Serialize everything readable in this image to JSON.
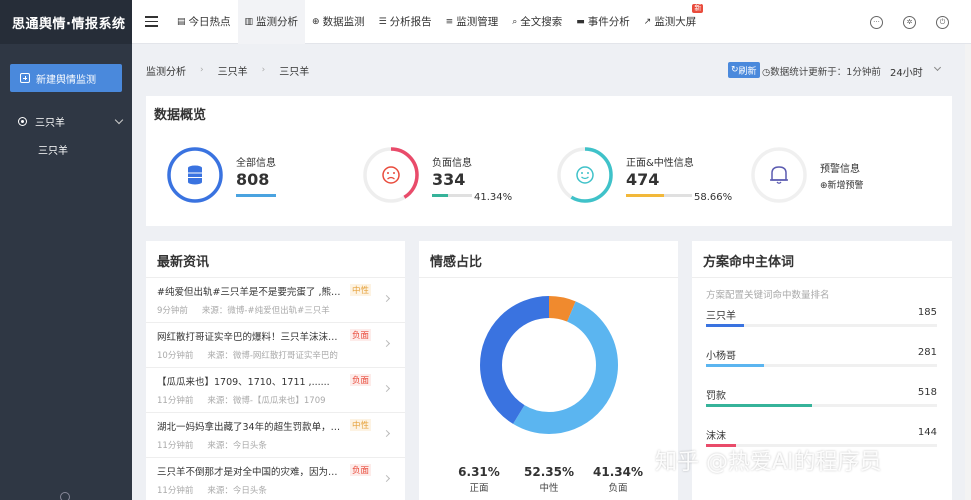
{
  "app": {
    "title": "思通舆情·情报系统"
  },
  "sidebar": {
    "new_button": "新建舆情监测",
    "group_label": "三只羊",
    "child_label": "三只羊"
  },
  "topnav": {
    "items": [
      {
        "label": "今日热点",
        "icon": "newspaper-icon"
      },
      {
        "label": "监测分析",
        "icon": "bar-chart-icon"
      },
      {
        "label": "数据监测",
        "icon": "crosshair-icon"
      },
      {
        "label": "分析报告",
        "icon": "list-icon"
      },
      {
        "label": "监测管理",
        "icon": "menu-list-icon"
      },
      {
        "label": "全文搜索",
        "icon": "search-icon"
      },
      {
        "label": "事件分析",
        "icon": "card-icon"
      },
      {
        "label": "监测大屏",
        "icon": "line-chart-icon",
        "badge": "新"
      }
    ]
  },
  "breadcrumb": {
    "items": [
      "监测分析",
      "三只羊",
      "三只羊"
    ]
  },
  "status": {
    "refresh_label": "刷新",
    "update_text": "数据统计更新于：1分钟前",
    "range": "24小时"
  },
  "overview": {
    "title": "数据概览",
    "total": {
      "label": "全部信息",
      "value": "808"
    },
    "negative": {
      "label": "负面信息",
      "value": "334",
      "percent": "41.34%"
    },
    "positive": {
      "label": "正面&中性信息",
      "value": "474",
      "percent": "58.66%"
    },
    "alert": {
      "label": "预警信息",
      "action": "新增预警"
    }
  },
  "news": {
    "title": "最新资讯",
    "items": [
      {
        "title": "#纯爱但出轨#三只羊是不是要完蛋了 ,熊大熊......",
        "time": "9分钟前",
        "source": "来源：微博-#纯爱但出轨#三只羊",
        "tag": "中性",
        "tag_type": "neutral"
      },
      {
        "title": "网红散打哥证实辛巴的爆料！三只羊沫沫被抓......",
        "time": "10分钟前",
        "source": "来源：微博-网红散打哥证实辛巴的",
        "tag": "负面",
        "tag_type": "negative"
      },
      {
        "title": "【瓜瓜来也】1709、1710、1711 ,......",
        "time": "11分钟前",
        "source": "来源：微博-【瓜瓜来也】1709",
        "tag": "负面",
        "tag_type": "negative"
      },
      {
        "title": "湖北一妈妈拿出藏了34年的超生罚款单，拍......",
        "time": "11分钟前",
        "source": "来源：今日头条",
        "tag": "中性",
        "tag_type": "neutral"
      },
      {
        "title": "三只羊不倒那才是对全中国的灾难，因为其他......",
        "time": "11分钟前",
        "source": "来源：今日头条",
        "tag": "负面",
        "tag_type": "negative"
      }
    ]
  },
  "sentiment": {
    "title": "情感占比",
    "colors": {
      "positive": "#f08a2e",
      "neutral": "#5bb5f0",
      "negative": "#3a73e0"
    }
  },
  "chart_data": {
    "type": "pie",
    "categories": [
      "正面",
      "中性",
      "负面"
    ],
    "values": [
      6.31,
      52.35,
      41.34
    ],
    "labels": [
      "6.31%",
      "52.35%",
      "41.34%"
    ]
  },
  "keywords": {
    "title": "方案命中主体词",
    "caption": "方案配置关键词命中数量排名",
    "items": [
      {
        "name": "三只羊",
        "count": 185,
        "color": "#3a73e0"
      },
      {
        "name": "小杨哥",
        "count": 281,
        "color": "#5bb5f0"
      },
      {
        "name": "罚款",
        "count": 518,
        "color": "#36b39a"
      },
      {
        "name": "沫沫",
        "count": 144,
        "color": "#e94b6a"
      }
    ]
  },
  "watermark": "知乎 @热爱AI的程序员"
}
